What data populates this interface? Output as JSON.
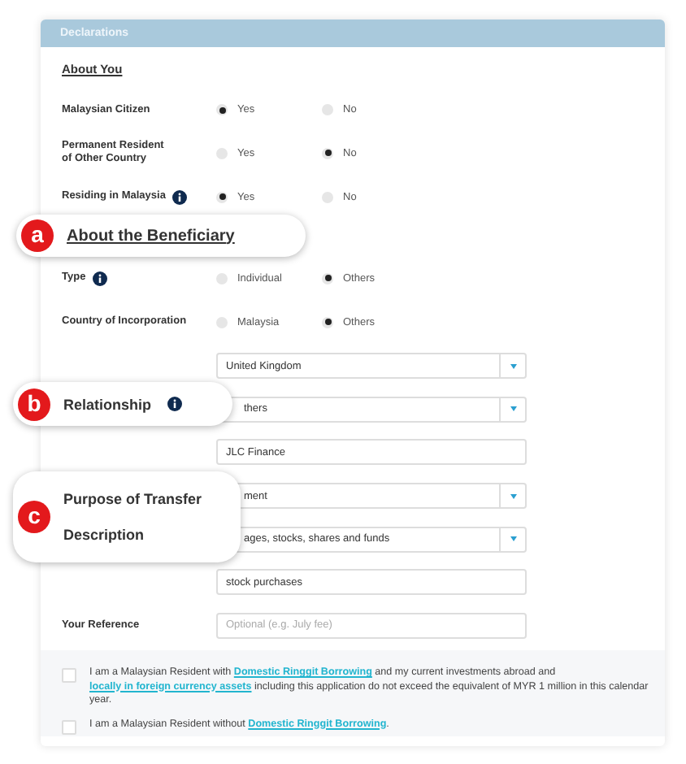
{
  "panel": {
    "title": "Declarations"
  },
  "section_heading": "About You",
  "questions": [
    {
      "label": "Malaysian Citizen",
      "options": [
        {
          "label": "Yes",
          "selected": true
        },
        {
          "label": "No",
          "selected": false
        }
      ]
    },
    {
      "label": "Permanent Resident of Other Country",
      "options": [
        {
          "label": "Yes",
          "selected": false
        },
        {
          "label": "No",
          "selected": true
        }
      ]
    },
    {
      "label": "Residing in Malaysia",
      "info": true,
      "options": [
        {
          "label": "Yes",
          "selected": true
        },
        {
          "label": "No",
          "selected": false
        }
      ]
    }
  ],
  "beneficiary_questions": [
    {
      "label": "Type",
      "info": true,
      "options": [
        {
          "label": "Individual",
          "selected": false
        },
        {
          "label": "Others",
          "selected": true
        }
      ]
    },
    {
      "label": "Country of Incorporation",
      "options": [
        {
          "label": "Malaysia",
          "selected": false
        },
        {
          "label": "Others",
          "selected": true
        }
      ]
    }
  ],
  "fields": [
    {
      "kind": "dropdown",
      "value": "United Kingdom"
    },
    {
      "kind": "dropdown",
      "value": "thers"
    },
    {
      "kind": "text",
      "value": "JLC Finance"
    },
    {
      "kind": "dropdown",
      "value": "ment"
    },
    {
      "kind": "dropdown",
      "value": "ages, stocks, shares and funds"
    },
    {
      "kind": "text",
      "value": "stock purchases"
    },
    {
      "kind": "text",
      "label": "Your Reference",
      "placeholder": "Optional (e.g. July fee)"
    }
  ],
  "declarations": [
    {
      "checked": false,
      "parts": [
        {
          "kind": "text",
          "text": "I am a Malaysian Resident with "
        },
        {
          "kind": "link",
          "text": "Domestic Ringgit Borrowing"
        },
        {
          "kind": "text",
          "text": " and my current investments abroad and "
        },
        {
          "kind": "link",
          "text": "locally in foreign currency assets"
        },
        {
          "kind": "text",
          "text": " including this application do not exceed the equivalent of MYR 1 million in this calendar year."
        }
      ]
    },
    {
      "checked": false,
      "parts": [
        {
          "kind": "text",
          "text": "I am a Malaysian Resident without "
        },
        {
          "kind": "link",
          "text": "Domestic Ringgit Borrowing"
        },
        {
          "kind": "text",
          "text": "."
        }
      ]
    }
  ],
  "callouts": [
    {
      "letter": "a",
      "kind": "heading",
      "lines": [
        "About the Beneficiary"
      ]
    },
    {
      "letter": "b",
      "kind": "label",
      "lines": [
        "Relationship"
      ],
      "info": true
    },
    {
      "letter": "c",
      "kind": "label",
      "lines": [
        "Purpose of Transfer",
        "Description"
      ]
    }
  ]
}
